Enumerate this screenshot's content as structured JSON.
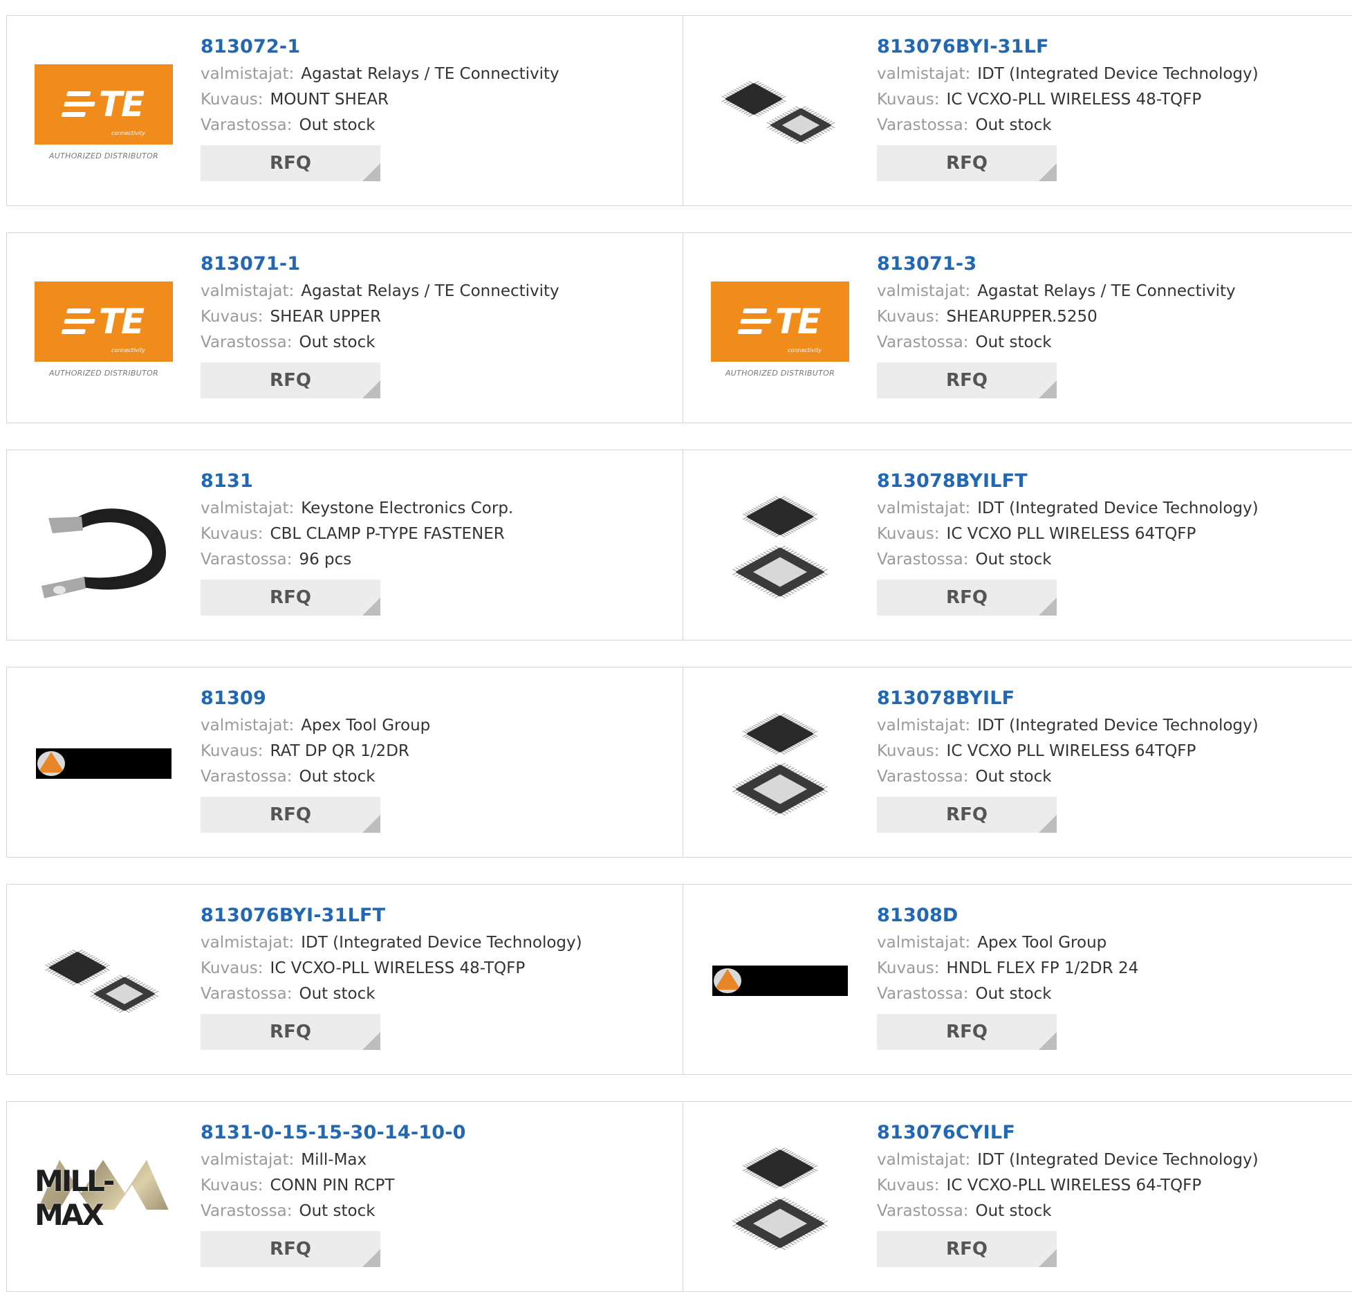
{
  "labels": {
    "manufacturer": "valmistajat:",
    "description": "Kuvaus:",
    "stock": "Varastossa:",
    "rfq": "RFQ"
  },
  "te_logo": {
    "text": "TE",
    "subtext": "connectivity",
    "authorized": "AUTHORIZED DISTRIBUTOR",
    "color": "#f08c1c"
  },
  "millmax_logo": {
    "text": "MILL-MAX"
  },
  "colors": {
    "part_number": "#2068b3",
    "label": "#9a9a9a",
    "value": "#333333",
    "rfq_bg": "#ececec"
  },
  "products": [
    {
      "part": "813072-1",
      "manufacturer": "Agastat Relays / TE Connectivity",
      "description": "MOUNT SHEAR",
      "stock": "Out stock",
      "image": "te-logo"
    },
    {
      "part": "813076BYI-31LF",
      "manufacturer": "IDT (Integrated Device Technology)",
      "description": "IC VCXO-PLL WIRELESS 48-TQFP",
      "stock": "Out stock",
      "image": "chip-48"
    },
    {
      "part": "813071-1",
      "manufacturer": "Agastat Relays / TE Connectivity",
      "description": "SHEAR UPPER",
      "stock": "Out stock",
      "image": "te-logo"
    },
    {
      "part": "813071-3",
      "manufacturer": "Agastat Relays / TE Connectivity",
      "description": "SHEARUPPER.5250",
      "stock": "Out stock",
      "image": "te-logo"
    },
    {
      "part": "8131",
      "manufacturer": "Keystone Electronics Corp.",
      "description": "CBL CLAMP P-TYPE FASTENER",
      "stock": "96 pcs",
      "image": "clamp"
    },
    {
      "part": "813078BYILFT",
      "manufacturer": "IDT (Integrated Device Technology)",
      "description": "IC VCXO PLL WIRELESS 64TQFP",
      "stock": "Out stock",
      "image": "chip-64"
    },
    {
      "part": "81309",
      "manufacturer": "Apex Tool Group",
      "description": "RAT DP QR 1/2DR",
      "stock": "Out stock",
      "image": "apex-logo"
    },
    {
      "part": "813078BYILF",
      "manufacturer": "IDT (Integrated Device Technology)",
      "description": "IC VCXO PLL WIRELESS 64TQFP",
      "stock": "Out stock",
      "image": "chip-64"
    },
    {
      "part": "813076BYI-31LFT",
      "manufacturer": "IDT (Integrated Device Technology)",
      "description": "IC VCXO-PLL WIRELESS 48-TQFP",
      "stock": "Out stock",
      "image": "chip-48"
    },
    {
      "part": "81308D",
      "manufacturer": "Apex Tool Group",
      "description": "HNDL FLEX FP 1/2DR 24",
      "stock": "Out stock",
      "image": "apex-logo"
    },
    {
      "part": "8131-0-15-15-30-14-10-0",
      "manufacturer": "Mill-Max",
      "description": "CONN PIN RCPT",
      "stock": "Out stock",
      "image": "millmax-logo"
    },
    {
      "part": "813076CYILF",
      "manufacturer": "IDT (Integrated Device Technology)",
      "description": "IC VCXO-PLL WIRELESS 64-TQFP",
      "stock": "Out stock",
      "image": "chip-64"
    }
  ]
}
